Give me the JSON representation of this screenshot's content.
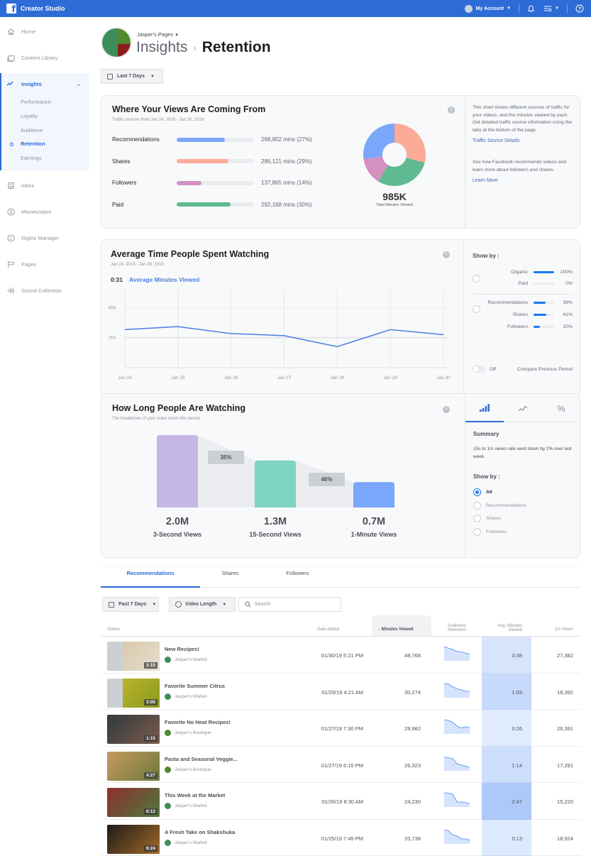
{
  "topbar": {
    "app_title": "Creator Studio",
    "account_label": "My Account"
  },
  "sidebar": {
    "items": [
      {
        "label": "Home",
        "icon": "home-icon"
      },
      {
        "label": "Content Library",
        "icon": "content-library-icon"
      }
    ],
    "insights": {
      "label": "Insights",
      "sub_items": [
        "Performance",
        "Loyalty",
        "Audience",
        "Retention",
        "Earnings"
      ],
      "active": "Retention"
    },
    "items_after": [
      {
        "label": "Inbox",
        "icon": "inbox-icon"
      },
      {
        "label": "Monetization",
        "icon": "dollar-icon"
      },
      {
        "label": "Rights Manager",
        "icon": "copyright-icon"
      },
      {
        "label": "Pages",
        "icon": "flag-icon"
      },
      {
        "label": "Sound Collection",
        "icon": "sound-wave-icon"
      }
    ]
  },
  "header": {
    "page_switch": "Jasper's Pages",
    "crumb_parent": "Insights",
    "crumb_current": "Retention",
    "date_filter": "Last 7 Days"
  },
  "views_source": {
    "title": "Where Your Views Are Coming From",
    "subtitle": "Traffic sources from Jan 24, 2019 - Jan 30, 2019",
    "total": "985K",
    "total_label": "Total Minutes Viewed",
    "side_text_1": "This chart shows different sources of traffic for your videos, and the minutes viewed by each. Get detailed traffic source information using the tabs at the bottom of the page.",
    "side_link_1": "Traffic Source Details",
    "side_text_2": "See how Facebook recommends videos and learn more about followers and shares.",
    "side_link_2": "Learn More"
  },
  "avg_time": {
    "title": "Average Time People Spent Watching",
    "subtitle": "Jan 24, 2019 - Jan 30, 2019",
    "value": "0:31",
    "metric_label": "Average Minutes Viewed",
    "show_by_label": "Show by :",
    "group1": [
      {
        "label": "Organic",
        "pct": 100,
        "text": "100%"
      },
      {
        "label": "Paid",
        "pct": 0,
        "text": "0%"
      }
    ],
    "group2": [
      {
        "label": "Recommendations",
        "pct": 39,
        "text": "39%"
      },
      {
        "label": "Shares",
        "pct": 41,
        "text": "41%"
      },
      {
        "label": "Followers",
        "pct": 20,
        "text": "20%"
      }
    ],
    "toggle_state": "Off",
    "toggle_label": "Compare Previous Period"
  },
  "how_long": {
    "title": "How Long People Are Watching",
    "subtitle": "The breakdown of your video views this period.",
    "summary_title": "Summary",
    "summary_text": "15s to 1m views rate went down by 2% over last week.",
    "show_by_label": "Show by :",
    "options": [
      "All",
      "Recommendations",
      "Shares",
      "Followers"
    ],
    "selected_option": "All",
    "tabs": [
      "bar-chart-icon",
      "line-chart-icon",
      "percent-icon"
    ]
  },
  "chart_data": [
    {
      "type": "pie",
      "title": "Where Your Views Are Coming From",
      "categories": [
        "Recommendations",
        "Shares",
        "Followers",
        "Paid"
      ],
      "values": [
        268802,
        286121,
        137865,
        292168
      ],
      "labels": [
        "268,802 mins (27%)",
        "286,121 mins (29%)",
        "137,865 mins (14%)",
        "292,168 mins (30%)"
      ],
      "percent": [
        27,
        29,
        14,
        30
      ],
      "colors": [
        "#7ba7fb",
        "#fbab97",
        "#d391c2",
        "#5fba92"
      ]
    },
    {
      "type": "line",
      "title": "Average Time People Spent Watching",
      "x": [
        "Jan 24",
        "Jan 25",
        "Jan 26",
        "Jan 27",
        "Jan 28",
        "Jan 29",
        "Jan 30"
      ],
      "series": [
        {
          "name": "Average Minutes Viewed",
          "values": [
            38,
            41,
            34,
            32,
            21,
            38,
            33
          ]
        }
      ],
      "yticks": [
        "30s",
        "60s"
      ],
      "ylim": [
        0,
        78
      ],
      "ylabel": "seconds",
      "grid": true,
      "color": "#4a7ee3"
    },
    {
      "type": "bar",
      "title": "How Long People Are Watching",
      "categories": [
        "3-Second Views",
        "15-Second Views",
        "1-Minute Views"
      ],
      "values": [
        2.0,
        1.3,
        0.7
      ],
      "value_labels": [
        "2.0M",
        "1.3M",
        "0.7M"
      ],
      "dropoff_labels": [
        "35%",
        "46%"
      ],
      "colors": [
        "#c5b7e5",
        "#7fd4c2",
        "#7aa7fb"
      ]
    }
  ],
  "bottom_tabs": [
    "Recommendations",
    "Shares",
    "Followers"
  ],
  "filters": {
    "period": "Past 7 Days",
    "length": "Video Length",
    "search_placeholder": "Search"
  },
  "table": {
    "columns": [
      "Videos",
      "Date Added",
      "↓ Minutes Viewed",
      "Audience Retention",
      "Avg. Minutes Viewed",
      "1m Views"
    ],
    "rows": [
      {
        "title": "New Recipes!",
        "page": "Jasper's Market",
        "duration": "2:15",
        "date": "01/30/19 5:21 PM",
        "minutes": "48,768",
        "avg": "0:38",
        "views": "27,382",
        "ret": [
          1,
          0.88,
          0.78,
          0.62,
          0.6,
          0.48,
          0.42
        ],
        "intensity": 0.35
      },
      {
        "title": "Favorite Summer Citrus",
        "page": "Jasper's Market",
        "duration": "3:05",
        "date": "01/29/19 4:21 AM",
        "minutes": "30,274",
        "avg": "1:03",
        "views": "18,392",
        "ret": [
          1,
          0.97,
          0.75,
          0.6,
          0.5,
          0.42,
          0.38
        ],
        "intensity": 0.6
      },
      {
        "title": "Favorite No Heat Recipes!",
        "page": "Jasper's Boutique",
        "duration": "1:15",
        "date": "01/27/19 7:30 PM",
        "minutes": "29,982",
        "avg": "0:26",
        "views": "26,391",
        "ret": [
          1,
          0.95,
          0.8,
          0.5,
          0.35,
          0.45,
          0.38
        ],
        "intensity": 0.2
      },
      {
        "title": "Pasta and Seasonal Veggie...",
        "page": "Jasper's Boutique",
        "duration": "4:27",
        "date": "01/27/19 6:15 PM",
        "minutes": "26,323",
        "avg": "1:14",
        "views": "17,281",
        "ret": [
          1,
          0.9,
          0.85,
          0.45,
          0.35,
          0.25,
          0.15
        ],
        "intensity": 0.5
      },
      {
        "title": "This Week at the Market",
        "page": "Jasper's Market",
        "duration": "6:12",
        "date": "01/26/19 8:30 AM",
        "minutes": "24,230",
        "avg": "2:47",
        "views": "15,220",
        "ret": [
          1,
          0.98,
          0.9,
          0.3,
          0.28,
          0.25,
          0.15
        ],
        "intensity": 1.0
      },
      {
        "title": "A Fresh Take on Shakshuka",
        "page": "Jasper's Market",
        "duration": "6:24",
        "date": "01/25/19 7:45 PM",
        "minutes": "20,738",
        "avg": "0:13",
        "views": "18,924",
        "ret": [
          1,
          0.92,
          0.62,
          0.5,
          0.3,
          0.28,
          0.18
        ],
        "intensity": 0.25
      }
    ]
  }
}
